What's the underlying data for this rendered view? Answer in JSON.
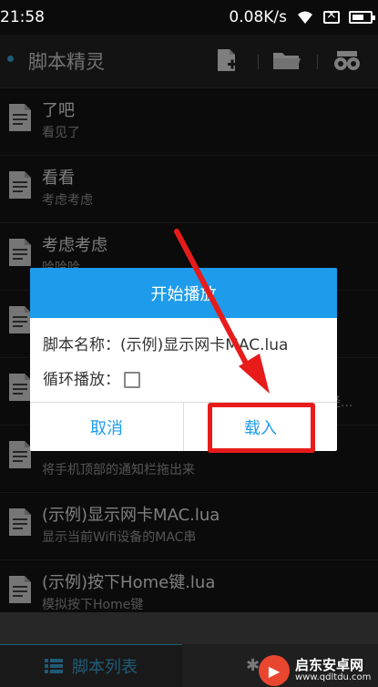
{
  "status": {
    "time": "21:58",
    "speed": "0.08K/s"
  },
  "app": {
    "title": "脚本精灵"
  },
  "list": [
    {
      "title": "了吧",
      "subtitle": "看见了"
    },
    {
      "title": "看看",
      "subtitle": "考虑考虑"
    },
    {
      "title": "考虑考虑",
      "subtitle": "哈哈哈"
    },
    {
      "title": "",
      "subtitle": ""
    },
    {
      "title": "",
      "subtitle": "经..."
    },
    {
      "title": "",
      "subtitle": "将手机顶部的通知栏拖出来"
    },
    {
      "title": "(示例)显示网卡MAC.lua",
      "subtitle": "显示当前Wifi设备的MAC串"
    },
    {
      "title": "(示例)按下Home键.lua",
      "subtitle": "模拟按下Home键"
    }
  ],
  "dialog": {
    "title": "开始播放",
    "script_name": "脚本名称：(示例)显示网卡MAC.lua",
    "loop_label": "循环播放：",
    "cancel": "取消",
    "load": "载入"
  },
  "tabs": {
    "active": "脚本列表"
  },
  "watermark": {
    "name": "启东安卓网",
    "url": "www.qdltdu.com"
  },
  "colors": {
    "accent": "#1e9bea",
    "annotation": "#e81b1b"
  }
}
